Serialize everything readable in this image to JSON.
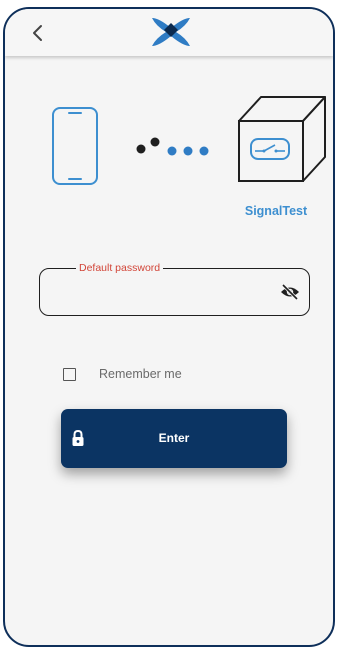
{
  "device": {
    "name": "SignalTest"
  },
  "login": {
    "password_label": "Default password",
    "password_value": "",
    "remember_label": "Remember me",
    "remember_checked": false,
    "enter_label": "Enter"
  },
  "icons": {
    "back": "chevron-left-icon",
    "logo": "app-logo",
    "phone": "smartphone-icon",
    "connection": "connection-dots-icon",
    "device": "device-box-icon",
    "visibility": "eye-off-icon",
    "lock": "lock-icon"
  },
  "colors": {
    "frame": "#0e2f5a",
    "accent_blue": "#3d8fd0",
    "button": "#0b3463",
    "error_label": "#d24538"
  }
}
